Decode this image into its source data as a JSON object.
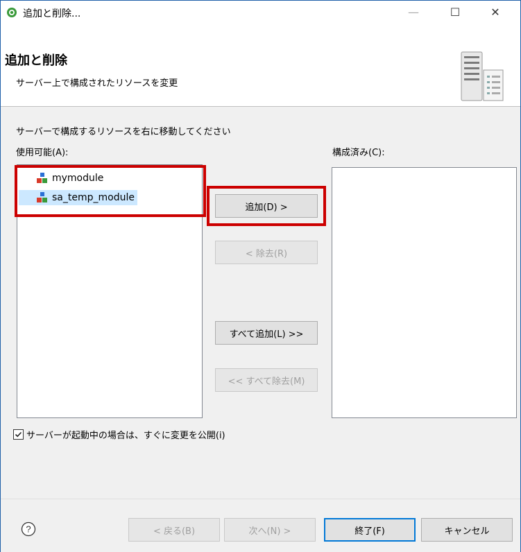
{
  "window": {
    "title": "追加と削除...",
    "minimize_glyph": "—",
    "maximize_glyph": "☐",
    "close_glyph": "✕"
  },
  "header": {
    "title": "追加と削除",
    "description": "サーバー上で構成されたリソースを変更"
  },
  "main": {
    "instruction": "サーバーで構成するリソースを右に移動してください",
    "available_label": "使用可能(A):",
    "configured_label": "構成済み(C):",
    "available_items": [
      {
        "label": "mymodule",
        "icon": "module-icon",
        "selected": false
      },
      {
        "label": "sa_temp_module",
        "icon": "module-icon",
        "selected": true
      }
    ],
    "configured_items": [],
    "buttons": {
      "add": "追加(D) >",
      "remove": "< 除去(R)",
      "add_all": "すべて追加(L) >>",
      "remove_all": "<< すべて除去(M)"
    },
    "publish_checkbox": {
      "label": "サーバーが起動中の場合は、すぐに変更を公開(i)",
      "checked": true
    }
  },
  "footer": {
    "help_icon": "help-icon",
    "back": "< 戻る(B)",
    "next": "次へ(N) >",
    "finish": "終了(F)",
    "cancel": "キャンセル"
  },
  "colors": {
    "highlight": "#cc0000",
    "selection": "#cce8ff",
    "default_button_border": "#0078d7"
  }
}
